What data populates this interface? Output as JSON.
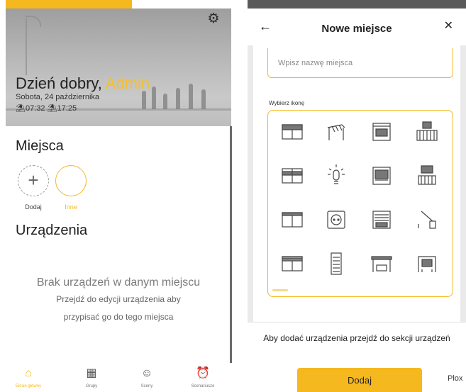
{
  "home": {
    "greeting_prefix": "Dzień dobry, ",
    "user_name": "Admin",
    "date": "Sobota, 24 października",
    "sunrise": "07:32",
    "sunset": "17:25",
    "places_title": "Miejsca",
    "add_label": "Dodaj",
    "other_label": "Inne",
    "devices_title": "Urządzenia",
    "empty_title": "Brak urządzeń w danym miejscu",
    "empty_line1": "Przejdź do edycji urządzenia aby",
    "empty_line2": "przypisać go do tego miejsca",
    "tabs": [
      {
        "label": "Ekran główny",
        "icon": "home-icon"
      },
      {
        "label": "Grupy",
        "icon": "grid-icon"
      },
      {
        "label": "Sceny",
        "icon": "mask-icon"
      },
      {
        "label": "Scenariusze",
        "icon": "alarm-clock-icon"
      }
    ]
  },
  "new_place": {
    "title": "Nowe miejsce",
    "name_placeholder": "Wpisz nazwę miejsca",
    "icon_label": "Wybierz ikonę",
    "hint": "Aby dodać urządzenia przejdź do sekcji urządzeń",
    "submit_label": "Dodaj",
    "extra_label": "Plox",
    "icons": [
      "shutter-icon",
      "pergola-icon",
      "garage-car-icon",
      "car-gate-icon",
      "window-blind-icon",
      "light-bulb-icon",
      "garage-door-icon",
      "car-fence-icon",
      "awning-window-icon",
      "socket-icon",
      "garage-shutter-icon",
      "barrier-icon",
      "roller-shutter-icon",
      "vertical-blind-icon",
      "carport-icon",
      "car-garage-open-icon"
    ]
  },
  "colors": {
    "accent": "#f5b81f"
  }
}
